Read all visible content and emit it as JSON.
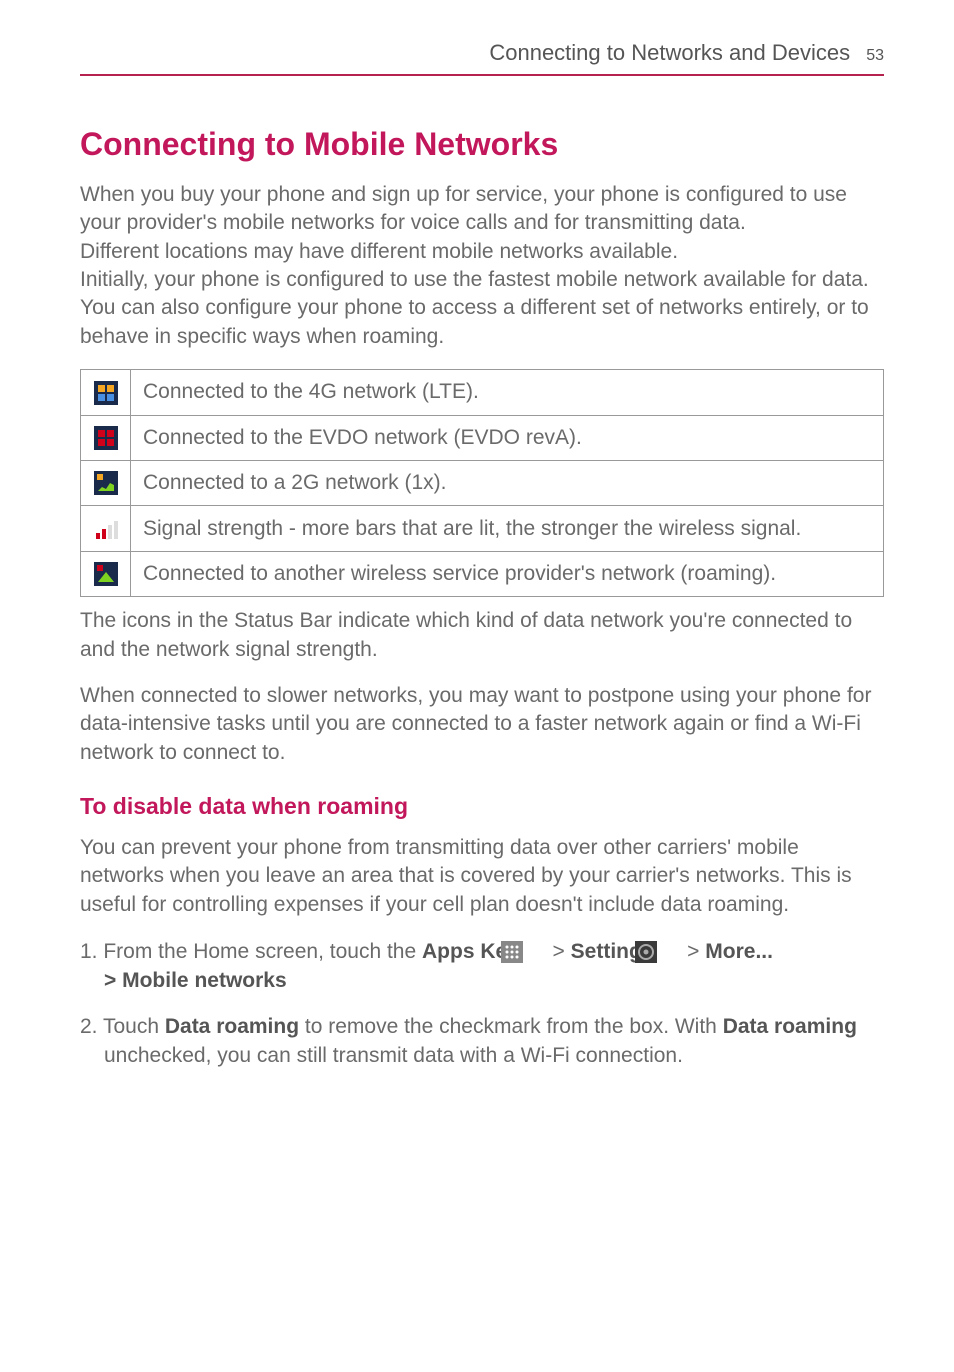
{
  "header": {
    "title": "Connecting to Networks and Devices",
    "page_number": "53"
  },
  "section_title": "Connecting to Mobile Networks",
  "intro_paragraphs": [
    "When you buy your phone and sign up for service, your phone is configured to use your provider's mobile networks for voice calls and for transmitting data.",
    "Different locations may have different mobile networks available.",
    "Initially, your phone is configured to use the fastest mobile network available for data. You can also configure your phone to access a different set of networks entirely, or to behave in specific ways when roaming."
  ],
  "table_rows": [
    {
      "icon": "4g-lte-icon",
      "desc": "Connected to the 4G network (LTE)."
    },
    {
      "icon": "evdo-icon",
      "desc": "Connected to the EVDO network (EVDO revA)."
    },
    {
      "icon": "2g-1x-icon",
      "desc": "Connected to a 2G network (1x)."
    },
    {
      "icon": "signal-bars-icon",
      "desc": "Signal strength -  more bars that are lit, the stronger the wireless signal."
    },
    {
      "icon": "roaming-icon",
      "desc": "Connected to another wireless service provider's network (roaming)."
    }
  ],
  "post_table_paragraphs": [
    "The icons in the Status Bar indicate which kind of data network you're connected to and the network signal strength.",
    "When connected to slower networks, you may want to postpone using your phone for data-intensive tasks until you are connected to a faster network again or find a Wi-Fi network to connect to."
  ],
  "subheading": "To disable data when roaming",
  "sub_paragraph": "You can prevent your phone from transmitting data over other carriers' mobile networks when you leave an area that is covered by your carrier's networks. This is useful for controlling expenses if your cell plan doesn't include data roaming.",
  "steps": {
    "step1": {
      "num": "1. ",
      "pre": "From the Home screen, touch the ",
      "apps_key": "Apps Key",
      "gt1": " > ",
      "settings": "Settings",
      "gt2": " > ",
      "more": "More...",
      "line2_gt": "> ",
      "mobile_networks": "Mobile networks"
    },
    "step2": {
      "num": "2. ",
      "pre": "Touch ",
      "data_roaming1": "Data roaming",
      "mid": " to remove the checkmark from the box. With ",
      "data_roaming2": "Data roaming",
      "post": " unchecked, you can still transmit data with a Wi-Fi connection."
    }
  }
}
